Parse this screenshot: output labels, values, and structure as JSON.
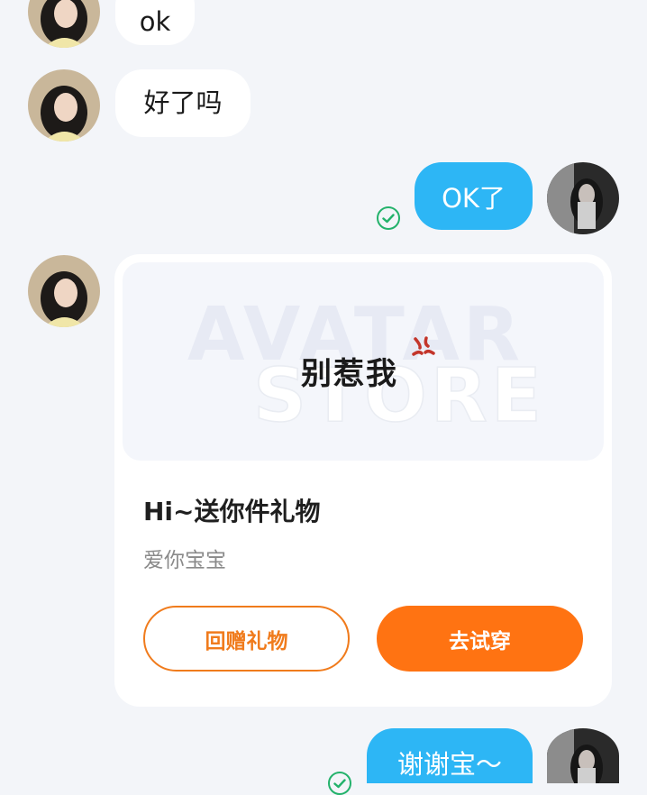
{
  "messages": {
    "msg1": {
      "text": "ok",
      "sender": "other"
    },
    "msg2": {
      "text": "好了吗",
      "sender": "other"
    },
    "msg3": {
      "text": "OK了",
      "sender": "me",
      "status": "sent"
    },
    "msg5": {
      "text": "谢谢宝～",
      "sender": "me",
      "status": "sent"
    }
  },
  "gift_card": {
    "preview_watermark_line1": "AVATAR",
    "preview_watermark_line2": "STORE",
    "preview_text": "别惹我",
    "title": "Hi~送你件礼物",
    "subtitle": "爱你宝宝",
    "return_gift_label": "回赠礼物",
    "try_on_label": "去试穿"
  },
  "colors": {
    "background": "#f3f5f9",
    "outgoing_bubble": "#2db6f5",
    "incoming_bubble": "#ffffff",
    "accent_orange": "#ff7312",
    "sent_check": "#23b26b"
  },
  "icons": {
    "sent_status": "check-circle-icon",
    "anger_mark": "anger-mark-icon"
  }
}
